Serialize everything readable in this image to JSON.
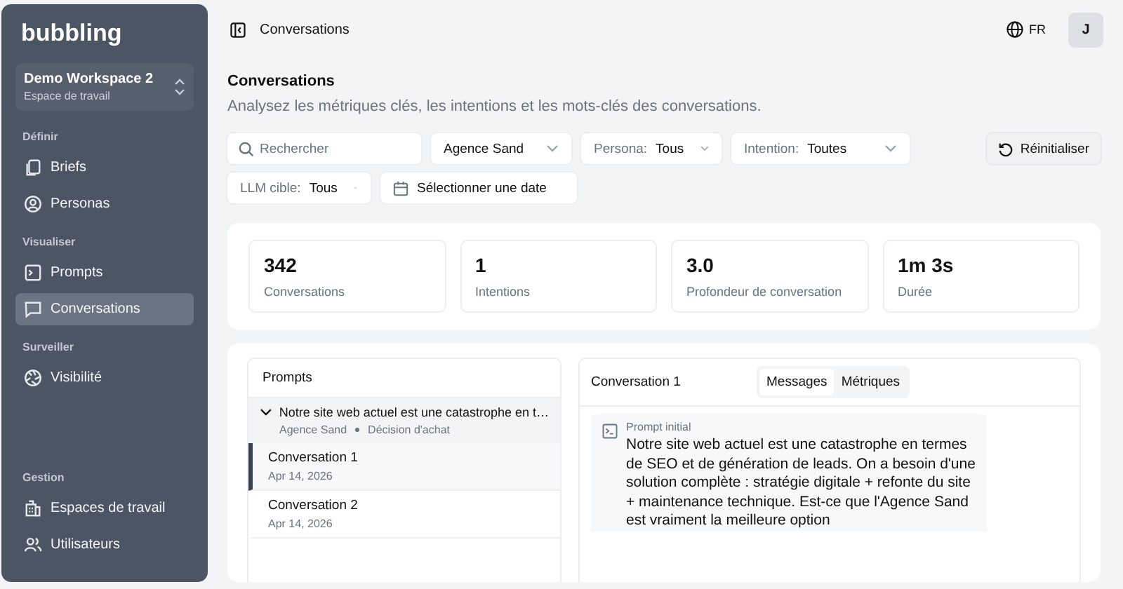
{
  "sidebar": {
    "logo": "bubbling",
    "workspace": {
      "name": "Demo Workspace 2",
      "subtitle": "Espace de travail"
    },
    "sections": [
      {
        "title": "Définir",
        "items": [
          {
            "label": "Briefs",
            "selected": false
          },
          {
            "label": "Personas",
            "selected": false
          }
        ]
      },
      {
        "title": "Visualiser",
        "items": [
          {
            "label": "Prompts",
            "selected": false
          },
          {
            "label": "Conversations",
            "selected": true
          }
        ]
      },
      {
        "title": "Surveiller",
        "items": [
          {
            "label": "Visibilité",
            "selected": false
          }
        ]
      },
      {
        "title": "Gestion",
        "items": [
          {
            "label": "Espaces de travail",
            "selected": false
          },
          {
            "label": "Utilisateurs",
            "selected": false
          }
        ]
      }
    ]
  },
  "topbar": {
    "title": "Conversations",
    "language": "FR",
    "avatar": "J"
  },
  "page": {
    "title": "Conversations",
    "subtitle": "Analysez les métriques clés, les intentions et les mots-clés des conversations."
  },
  "filters": [
    {
      "kind": "search",
      "placeholder": "Rechercher"
    },
    {
      "kind": "select",
      "value": "Agence Sand"
    },
    {
      "kind": "select",
      "label": "Persona:",
      "value": "Tous"
    },
    {
      "kind": "select",
      "label": "Intention:",
      "value": "Toutes"
    },
    {
      "kind": "select",
      "label": "LLM cible:",
      "value": "Tous"
    },
    {
      "kind": "date",
      "value": "Sélectionner une date"
    }
  ],
  "reset_button": "Réinitialiser",
  "stats": [
    {
      "value": "342",
      "label": "Conversations"
    },
    {
      "value": "1",
      "label": "Intentions"
    },
    {
      "value": "3.0",
      "label": "Profondeur de conversation"
    },
    {
      "value": "1m 3s",
      "label": "Durée"
    }
  ],
  "prompts_panel": {
    "title": "Prompts",
    "groups": [
      {
        "text": "Notre site web actuel est une catastrophe en t…",
        "expanded": true,
        "brand": "Agence Sand",
        "intent": "Décision d'achat",
        "conversations": [
          {
            "title": "Conversation 1",
            "date": "Apr 14, 2026",
            "selected": true
          },
          {
            "title": "Conversation 2",
            "date": "Apr 14, 2026",
            "selected": false
          }
        ]
      }
    ]
  },
  "conversation_panel": {
    "title": "Conversation 1",
    "tabs": [
      {
        "label": "Messages",
        "selected": true
      },
      {
        "label": "Métriques",
        "selected": false
      }
    ],
    "message": {
      "label": "Prompt initial",
      "text": "Notre site web actuel est une catastrophe en termes de SEO et de génération de leads. On a besoin d'une solution complète : stratégie digitale + refonte du site + maintenance technique. Est-ce que l'Agence Sand est vraiment la meilleure option"
    }
  }
}
